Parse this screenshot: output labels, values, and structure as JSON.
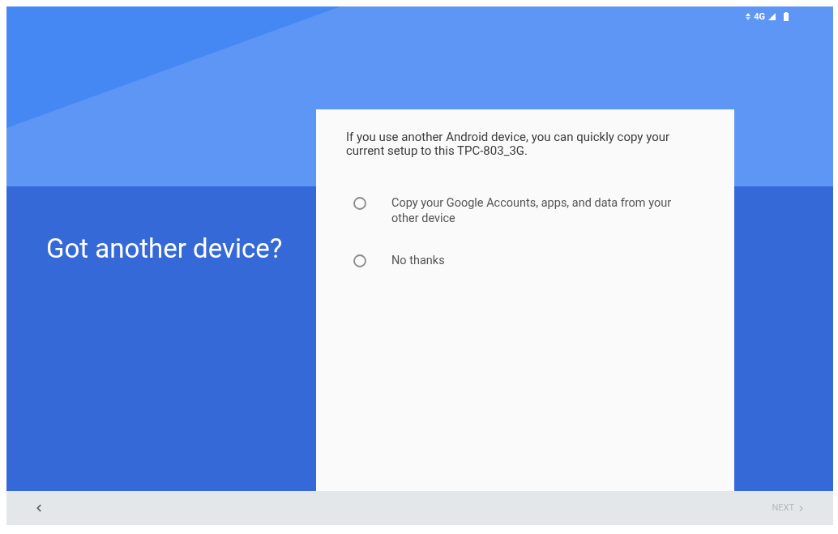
{
  "status_bar": {
    "network": "4G"
  },
  "heading": "Got another device?",
  "card": {
    "intro": "If you use another Android device, you can quickly copy your current setup to this TPC-803_3G.",
    "options": [
      {
        "label": "Copy your Google Accounts, apps, and data from your other device",
        "selected": false
      },
      {
        "label": "No thanks",
        "selected": false
      }
    ]
  },
  "nav_bar": {
    "next": {
      "label": "NEXT",
      "disabled": true
    }
  }
}
